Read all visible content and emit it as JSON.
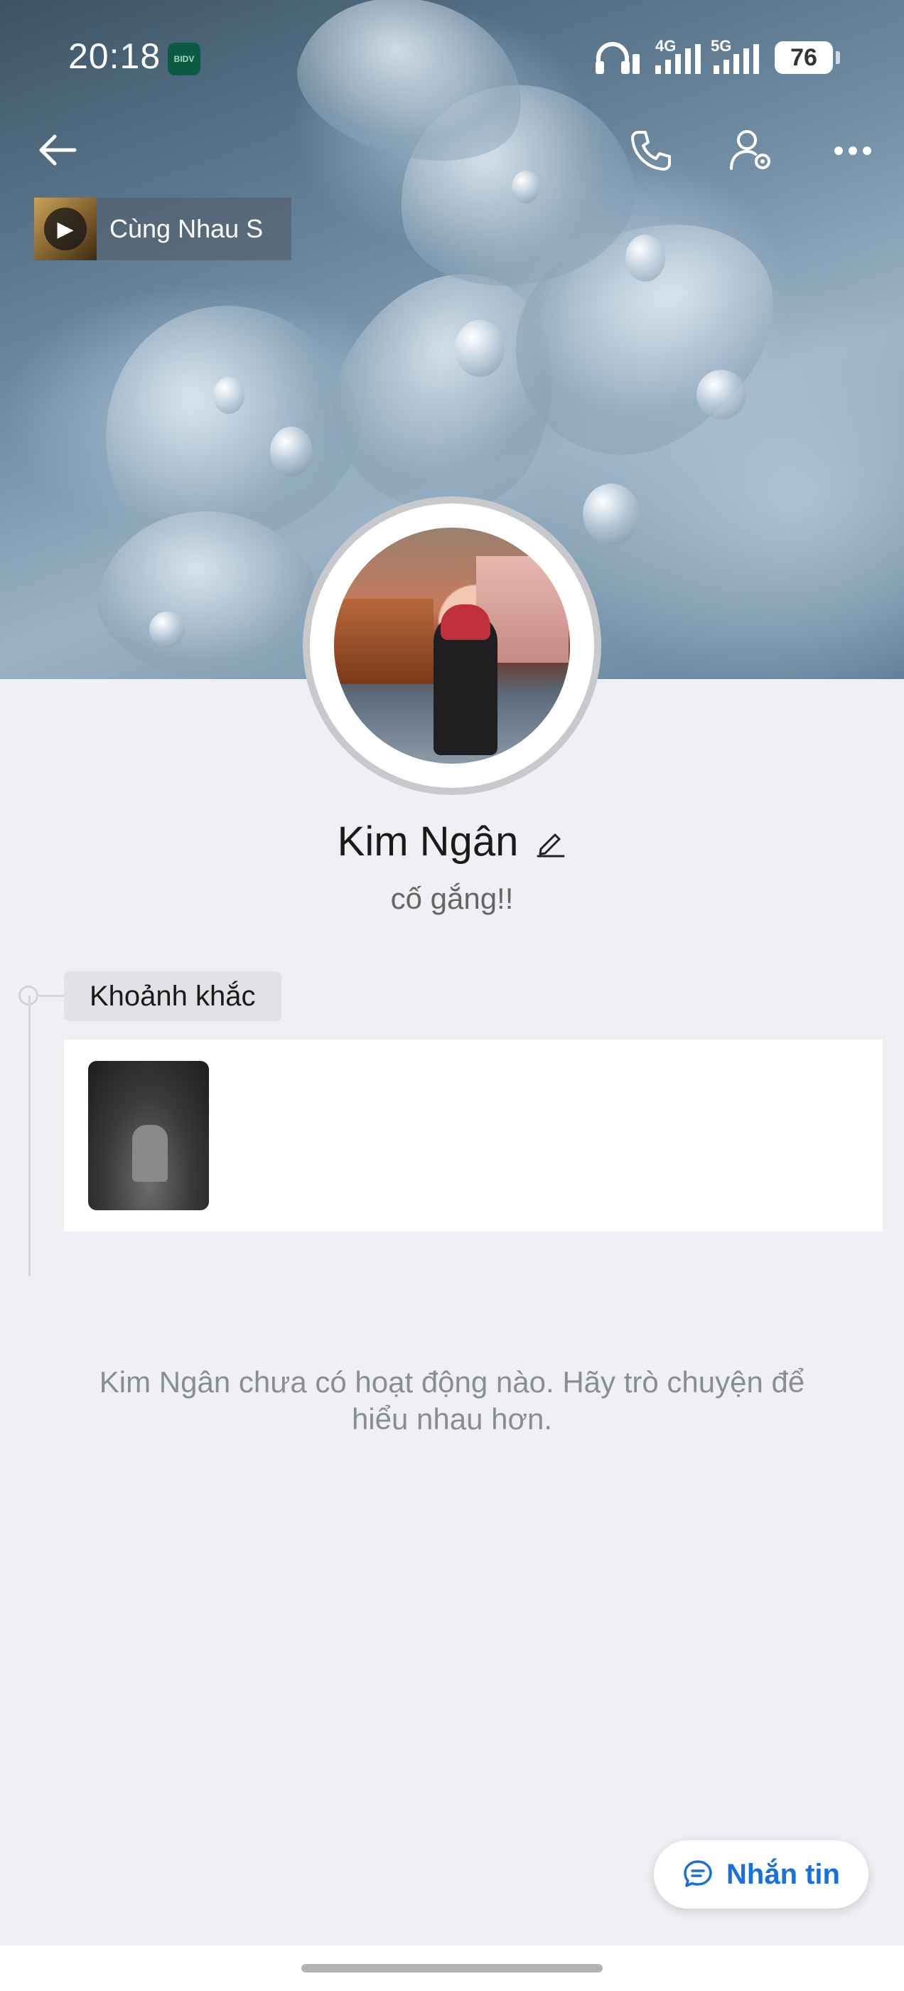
{
  "status_bar": {
    "time": "20:18",
    "app_badge": "BIDV",
    "net1": "4G",
    "net2": "5G",
    "battery": "76"
  },
  "music": {
    "title": "Cùng Nhau S"
  },
  "profile": {
    "name": "Kim Ngân",
    "status": "cố gắng!!"
  },
  "moments": {
    "label": "Khoảnh khắc"
  },
  "empty_message": "Kim Ngân chưa có hoạt động nào. Hãy trò chuyện để hiểu nhau hơn.",
  "actions": {
    "message_button": "Nhắn tin"
  },
  "colors": {
    "accent": "#1a6fe0",
    "background": "#eff0f4"
  }
}
